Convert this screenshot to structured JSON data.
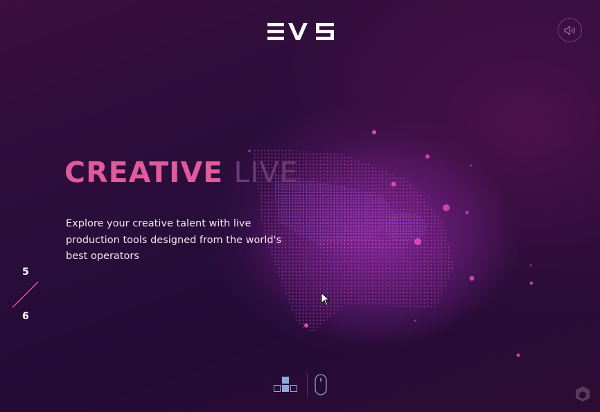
{
  "header": {
    "logo_text": "EVS",
    "sound_icon": "speaker-icon"
  },
  "hero": {
    "title_strong": "CREATIVE",
    "title_light": "LIVE",
    "description": "Explore your creative talent with live production tools designed from the world's best operators"
  },
  "pager": {
    "current": "5",
    "total": "6"
  },
  "bottom_nav": {
    "grid_icon": "blocks-grid-icon",
    "scroll_icon": "mouse-scroll-icon"
  },
  "colors": {
    "accent": "#e15a9c",
    "title_light": "#6a3b74",
    "background_deep": "#230b36",
    "background_top": "#3a0e3e"
  }
}
